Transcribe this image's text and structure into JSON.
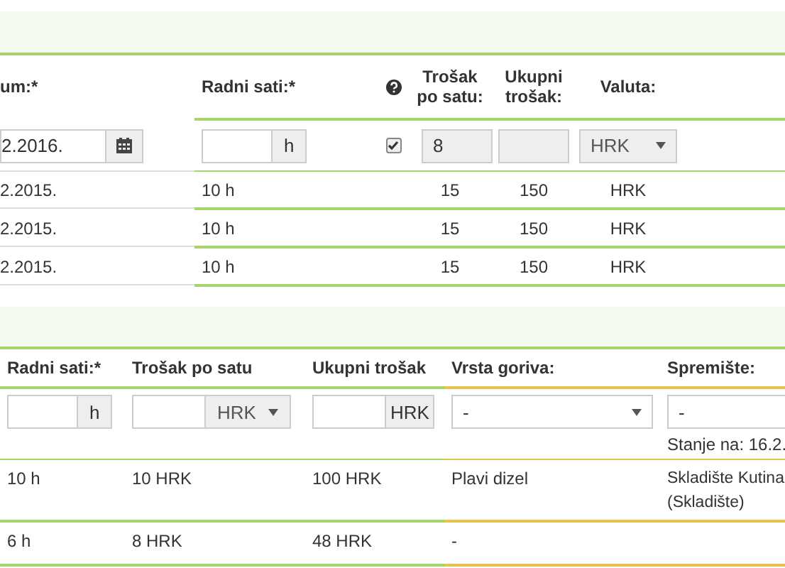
{
  "sections": [
    {
      "columns": [
        {
          "label": "um:*"
        },
        {
          "label": "Radni sati:*"
        },
        {
          "kind": "help"
        },
        {
          "label": "Trošak po satu:"
        },
        {
          "label": "Ukupni trošak:"
        },
        {
          "label": "Valuta:"
        }
      ],
      "input_row": [
        {
          "kind": "date",
          "value": "2.2016."
        },
        {
          "kind": "addon",
          "addon": "h"
        },
        {
          "kind": "checkbox",
          "checked": true
        },
        {
          "kind": "readonly",
          "value": "8"
        },
        {
          "kind": "readonly"
        },
        {
          "kind": "select",
          "value": "HRK"
        }
      ],
      "rows": [
        [
          "2.2015.",
          "10 h",
          "",
          "15",
          "150",
          "HRK"
        ],
        [
          "2.2015.",
          "10 h",
          "",
          "15",
          "150",
          "HRK"
        ],
        [
          "2.2015.",
          "10 h",
          "",
          "15",
          "150",
          "HRK"
        ]
      ]
    },
    {
      "columns": [
        {
          "label": "Radni sati:*"
        },
        {
          "label": "Trošak po satu"
        },
        {
          "label": "Ukupni trošak"
        },
        {
          "label": "Vrsta goriva:"
        },
        {
          "label": "Spremište:"
        }
      ],
      "input_row": [
        {
          "kind": "addon",
          "addon": "h"
        },
        {
          "kind": "select-addon",
          "addon": "HRK"
        },
        {
          "kind": "addon",
          "addon": "HRK"
        },
        {
          "kind": "select",
          "value": "-"
        },
        {
          "kind": "text",
          "value": "-",
          "note": "Stanje na: 16.2."
        }
      ],
      "rows": [
        [
          "10 h",
          "10 HRK",
          "100 HRK",
          "Plavi dizel",
          "Skladište Kutina\n(Skladište)"
        ],
        [
          "6 h",
          "8 HRK",
          "48 HRK",
          "-",
          ""
        ]
      ]
    }
  ]
}
